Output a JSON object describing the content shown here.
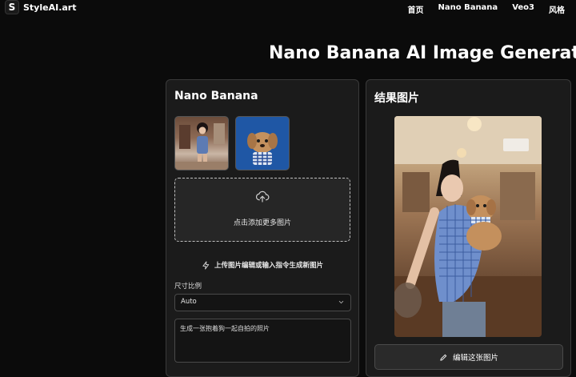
{
  "app": {
    "logo_letter": "S",
    "name": "StyleAI.art"
  },
  "nav": {
    "links": [
      "首页",
      "Nano Banana",
      "Veo3",
      "风格"
    ]
  },
  "page_title": "Nano Banana AI Image Generator",
  "left_panel": {
    "title": "Nano Banana",
    "upload_text": "点击添加更多图片",
    "hint": "上传图片编辑或输入指令生成新图片",
    "size_label": "尺寸比例",
    "size_value": "Auto",
    "prompt_value": "生成一张抱着狗一起自拍的照片"
  },
  "right_panel": {
    "title": "结果图片",
    "edit_button": "编辑这张图片"
  },
  "colors": {
    "background": "#0b0b0b",
    "panel": "#1b1b1b",
    "thumb_blue": "#1f57a5"
  },
  "icons": [
    "upload-cloud-icon",
    "lightning-icon",
    "chevron-down-icon",
    "pencil-icon"
  ]
}
